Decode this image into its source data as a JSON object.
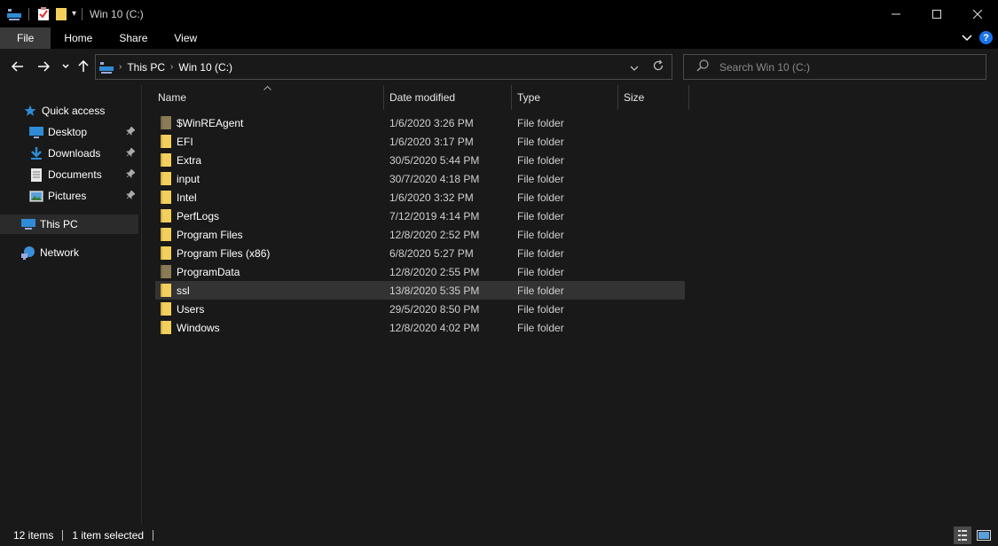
{
  "window": {
    "title": "Win 10 (C:)",
    "controls": {
      "minimize": "—",
      "maximize": "☐",
      "close": "✕"
    }
  },
  "ribbon": {
    "tabs": [
      "File",
      "Home",
      "Share",
      "View"
    ],
    "help": "?"
  },
  "nav": {
    "address": {
      "root_icon": "pc-icon",
      "crumbs": [
        "This PC",
        "Win 10 (C:)"
      ]
    },
    "search_placeholder": "Search Win 10 (C:)"
  },
  "sidebar": {
    "items": [
      {
        "label": "Quick access",
        "icon": "star-icon",
        "pinned": false
      },
      {
        "label": "Desktop",
        "icon": "desktop-icon",
        "pinned": true
      },
      {
        "label": "Downloads",
        "icon": "download-icon",
        "pinned": true
      },
      {
        "label": "Documents",
        "icon": "documents-icon",
        "pinned": true
      },
      {
        "label": "Pictures",
        "icon": "pictures-icon",
        "pinned": true
      },
      {
        "label": "This PC",
        "icon": "pc-icon",
        "pinned": false,
        "selected": true
      },
      {
        "label": "Network",
        "icon": "network-icon",
        "pinned": false
      }
    ]
  },
  "columns": [
    "Name",
    "Date modified",
    "Type",
    "Size"
  ],
  "files": [
    {
      "name": "$WinREAgent",
      "date": "1/6/2020 3:26 PM",
      "type": "File folder",
      "hidden": true
    },
    {
      "name": "EFI",
      "date": "1/6/2020 3:17 PM",
      "type": "File folder"
    },
    {
      "name": "Extra",
      "date": "30/5/2020 5:44 PM",
      "type": "File folder"
    },
    {
      "name": "input",
      "date": "30/7/2020 4:18 PM",
      "type": "File folder"
    },
    {
      "name": "Intel",
      "date": "1/6/2020 3:32 PM",
      "type": "File folder"
    },
    {
      "name": "PerfLogs",
      "date": "7/12/2019 4:14 PM",
      "type": "File folder"
    },
    {
      "name": "Program Files",
      "date": "12/8/2020 2:52 PM",
      "type": "File folder"
    },
    {
      "name": "Program Files (x86)",
      "date": "6/8/2020 5:27 PM",
      "type": "File folder"
    },
    {
      "name": "ProgramData",
      "date": "12/8/2020 2:55 PM",
      "type": "File folder",
      "hidden": true
    },
    {
      "name": "ssl",
      "date": "13/8/2020 5:35 PM",
      "type": "File folder",
      "selected": true
    },
    {
      "name": "Users",
      "date": "29/5/2020 8:50 PM",
      "type": "File folder"
    },
    {
      "name": "Windows",
      "date": "12/8/2020 4:02 PM",
      "type": "File folder"
    }
  ],
  "status": {
    "count": "12 items",
    "selection": "1 item selected"
  },
  "colors": {
    "folder": "#f5cf5b",
    "folder_hidden": "#8a7a55",
    "accent": "#1a73e8"
  }
}
